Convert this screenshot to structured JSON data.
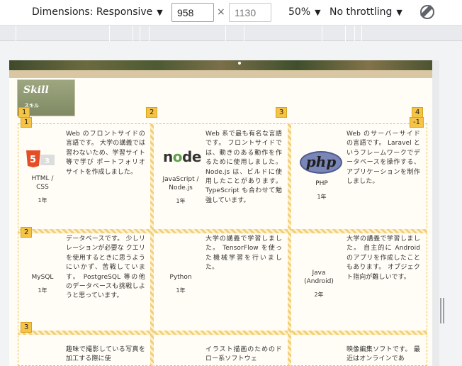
{
  "toolbar": {
    "dimensions_label": "Dimensions: Responsive",
    "width_value": "958",
    "height_placeholder": "1130",
    "times": "×",
    "zoom_label": "50%",
    "throttling_label": "No throttling",
    "rotate_icon": "rotate-icon"
  },
  "page": {
    "skill_title": "Skill",
    "skill_subtitle": "スキル",
    "grid_numbers": {
      "col_1": "1",
      "col_2": "2",
      "col_3": "3",
      "col_4": "4",
      "col_neg": "-1",
      "row_1": "1",
      "row_2": "2",
      "row_3": "3"
    },
    "skills": [
      {
        "name": "HTML /\nCSS",
        "years": "1年",
        "icon": "html5-icon",
        "desc": "Web のフロントサイドの言語です。 大学の講義では習わないため、学習サイト等で学び ポートフォリオサイトを作成しました。"
      },
      {
        "name": "JavaScript /\nNode.js",
        "years": "1年",
        "icon": "nodejs-icon",
        "desc": "Web 系で最も有名な言語です。 フロントサイドでは、動きのある動作を作るために使用しました。 Node.js は、ビルドに使用したことがあります。 TypeScript も合わせて勉強しています。"
      },
      {
        "name": "PHP",
        "years": "1年",
        "icon": "php-icon",
        "desc": "Web のサーバーサイドの言語です。 Laravel というフレームワークでデータベースを操作する、アプリケーションを制作しました。"
      },
      {
        "name": "MySQL",
        "years": "1年",
        "desc": "データベースです。 少しリレーションが必要な クエリを使用するときに思うようにいかず、苦戦しています。 PostgreSQL 等の他のデータベースも挑戦しようと思っています。"
      },
      {
        "name": "Python",
        "years": "1年",
        "desc": "大学の講義で学習しました。 TensorFlow を使った機械学習を行いました。"
      },
      {
        "name": "Java\n(Android)",
        "years": "2年",
        "desc": "大学の講義で学習しました。 自主的に Android のアプリを作成したこともあります。 オブジェクト指向が難しいです。"
      },
      {
        "desc": "趣味で撮影している写真を加工する際に使"
      },
      {
        "desc": "イラスト描画のためのドロー系ソフトウェ"
      },
      {
        "desc": "映像編集ソフトです。 最近はオンラインであ"
      }
    ]
  }
}
